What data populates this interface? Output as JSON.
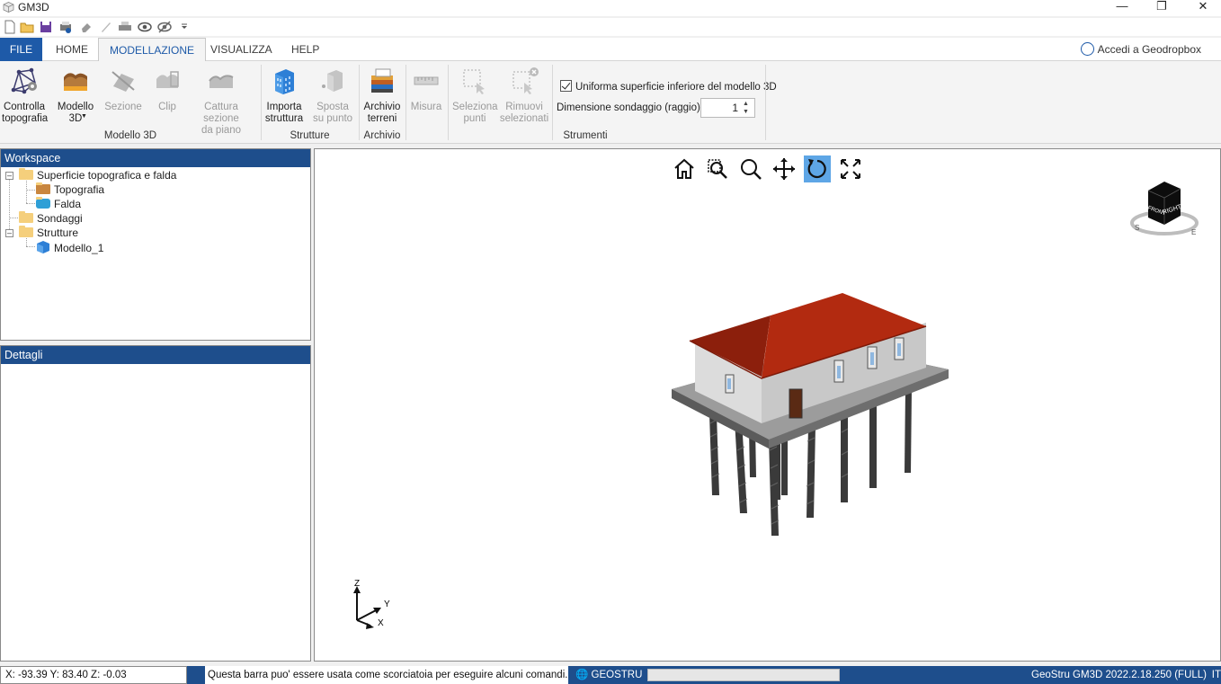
{
  "window": {
    "title": "GM3D"
  },
  "tabs": [
    {
      "label": "FILE"
    },
    {
      "label": "HOME"
    },
    {
      "label": "MODELLAZIONE"
    },
    {
      "label": "VISUALIZZA"
    },
    {
      "label": "HELP"
    }
  ],
  "account": {
    "label": "Accedi a Geodropbox"
  },
  "ribbon": {
    "controlla_topografia": "Controlla\ntopografia",
    "modello_3d": "Modello\n3D",
    "sezione": "Sezione",
    "clip": "Clip",
    "cattura_sezione": "Cattura sezione\nda piano",
    "importa_struttura": "Importa\nstruttura",
    "sposta_su_punto": "Sposta\nsu punto",
    "archivio_terreni": "Archivio\nterreni",
    "misura": "Misura",
    "seleziona_punti": "Seleziona\npunti",
    "rimuovi_selezionati": "Rimuovi\nselezionati",
    "uniforma_label": "Uniforma superficie inferiore del modello 3D",
    "uniforma_checked": true,
    "dimensione_label": "Dimensione sondaggio (raggio) m",
    "dimensione_value": "1",
    "groups": {
      "modello3d": "Modello 3D",
      "strutture": "Strutture",
      "archivio": "Archivio",
      "strumenti": "Strumenti"
    }
  },
  "workspace": {
    "title": "Workspace",
    "tree": {
      "superficie": "Superficie topografica e falda",
      "topografia": "Topografia",
      "falda": "Falda",
      "sondaggi": "Sondaggi",
      "strutture": "Strutture",
      "modello_1": "Modello_1"
    }
  },
  "details": {
    "title": "Dettagli"
  },
  "viewport": {
    "active_tool": "rotate",
    "navcube_face": "RIGHT",
    "navcube_side": "FRONT",
    "compass": {
      "s": "S",
      "e": "E"
    },
    "axes": {
      "z": "Z",
      "y": "Y",
      "x": "X"
    }
  },
  "status": {
    "coords": "X: -93.39   Y: 83.40   Z: -0.03",
    "command_hint": "Questa barra puo' essere usata come scorciatoia per eseguire alcuni comandi.",
    "brand": "GEOSTRU",
    "version": "GeoStru GM3D 2022.2.18.250 (FULL)",
    "lang": "IT"
  },
  "colors": {
    "accent": "#1e5aa8",
    "panel_header": "#1e4e8c",
    "roof": "#b22a10",
    "active_tool": "#5ea6e6"
  }
}
